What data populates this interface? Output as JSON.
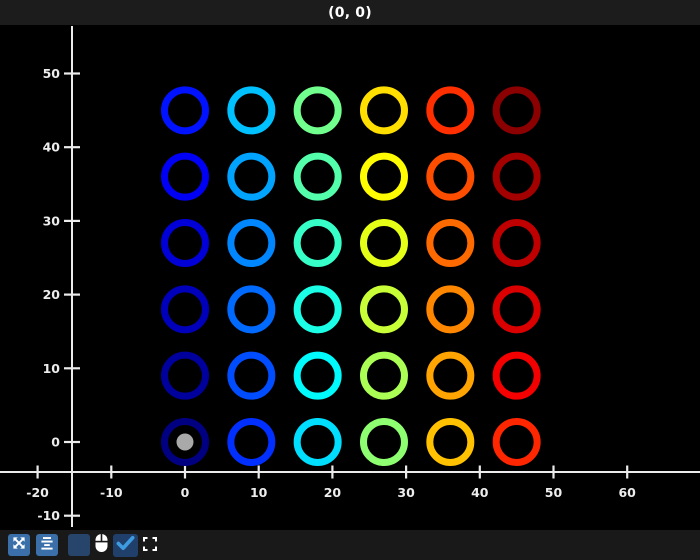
{
  "window": {
    "title": "(0, 0)"
  },
  "chart_data": {
    "type": "scatter",
    "title": "(0, 0)",
    "description": "6x6 grid of ring (hollow circle) markers on black background, colored along a jet rainbow colormap ordered column by column from bottom-left (navy) to top-right (dark red); the point at the origin is highlighted with a gray dot and its coordinates (0, 0) are shown in the window title.",
    "x_axis": {
      "ticks": [
        -20,
        -10,
        0,
        10,
        20,
        30,
        40,
        50,
        60
      ],
      "visible_range": [
        -25,
        70
      ]
    },
    "y_axis": {
      "ticks": [
        50,
        40,
        30,
        20,
        10,
        0,
        -10
      ],
      "visible_range": [
        -14,
        54
      ]
    },
    "grid": false,
    "legend": false,
    "style": {
      "background": "#000000",
      "axis_color": "#ebebeb",
      "tick_label_color": "#ededed",
      "marker_shape": "ring",
      "marker_outer_radius_px": 24,
      "marker_stroke_px": 7
    },
    "highlight": {
      "x": 0,
      "y": 0,
      "color": "#a9a9a9",
      "meaning": "selected point at origin"
    },
    "points": [
      {
        "x": 0,
        "y": 0,
        "color": "#000080"
      },
      {
        "x": 0,
        "y": 9,
        "color": "#00009d"
      },
      {
        "x": 0,
        "y": 18,
        "color": "#0000ba"
      },
      {
        "x": 0,
        "y": 27,
        "color": "#0000d7"
      },
      {
        "x": 0,
        "y": 36,
        "color": "#0000f4"
      },
      {
        "x": 0,
        "y": 45,
        "color": "#0012ff"
      },
      {
        "x": 9,
        "y": 0,
        "color": "#002fff"
      },
      {
        "x": 9,
        "y": 9,
        "color": "#004dff"
      },
      {
        "x": 9,
        "y": 18,
        "color": "#006aff"
      },
      {
        "x": 9,
        "y": 27,
        "color": "#0087ff"
      },
      {
        "x": 9,
        "y": 36,
        "color": "#00a4ff"
      },
      {
        "x": 9,
        "y": 45,
        "color": "#00c1ff"
      },
      {
        "x": 18,
        "y": 0,
        "color": "#00deff"
      },
      {
        "x": 18,
        "y": 9,
        "color": "#00fbff"
      },
      {
        "x": 18,
        "y": 18,
        "color": "#1affe6"
      },
      {
        "x": 18,
        "y": 27,
        "color": "#37ffc8"
      },
      {
        "x": 18,
        "y": 36,
        "color": "#54ffab"
      },
      {
        "x": 18,
        "y": 45,
        "color": "#71ff8e"
      },
      {
        "x": 27,
        "y": 0,
        "color": "#8eff71"
      },
      {
        "x": 27,
        "y": 9,
        "color": "#abff54"
      },
      {
        "x": 27,
        "y": 18,
        "color": "#c8ff37"
      },
      {
        "x": 27,
        "y": 27,
        "color": "#e6ff16"
      },
      {
        "x": 27,
        "y": 36,
        "color": "#fffb00"
      },
      {
        "x": 27,
        "y": 45,
        "color": "#ffde00"
      },
      {
        "x": 36,
        "y": 0,
        "color": "#ffc100"
      },
      {
        "x": 36,
        "y": 9,
        "color": "#ffa400"
      },
      {
        "x": 36,
        "y": 18,
        "color": "#ff8700"
      },
      {
        "x": 36,
        "y": 27,
        "color": "#ff6a00"
      },
      {
        "x": 36,
        "y": 36,
        "color": "#ff4d00"
      },
      {
        "x": 36,
        "y": 45,
        "color": "#ff2f00"
      },
      {
        "x": 45,
        "y": 0,
        "color": "#ff2600"
      },
      {
        "x": 45,
        "y": 9,
        "color": "#f40000"
      },
      {
        "x": 45,
        "y": 18,
        "color": "#da0000"
      },
      {
        "x": 45,
        "y": 27,
        "color": "#c00000"
      },
      {
        "x": 45,
        "y": 36,
        "color": "#a30000"
      },
      {
        "x": 45,
        "y": 45,
        "color": "#8b0000"
      }
    ]
  },
  "toolbar": {
    "buttons": [
      {
        "name": "pan-button",
        "icon": "expand-arrows-icon",
        "bg": "#3a6fa9",
        "fg": "#ffffff"
      },
      {
        "name": "center-button",
        "icon": "align-center-lines-icon",
        "bg": "#3a6fa9",
        "fg": "#ffffff"
      },
      {
        "name": "blank-toggle",
        "icon": "none",
        "bg": "#27456b",
        "fg": ""
      },
      {
        "name": "mouse-mode-button",
        "icon": "mouse-icon",
        "bg": "transparent",
        "fg": "#ffffff"
      },
      {
        "name": "confirm-toggle",
        "icon": "checkmark-icon",
        "bg": "#20406b",
        "fg": "#3f9be0"
      },
      {
        "name": "fullscreen-button",
        "icon": "fullscreen-corners-icon",
        "bg": "transparent",
        "fg": "#ffffff"
      }
    ]
  }
}
